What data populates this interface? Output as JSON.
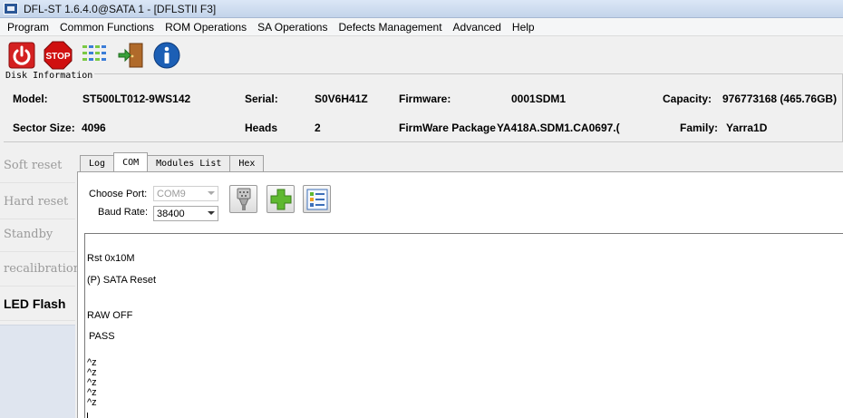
{
  "window": {
    "title": "DFL-ST 1.6.4.0@SATA 1 - [DFLSTII  F3]"
  },
  "menu": [
    "Program",
    "Common Functions",
    "ROM Operations",
    "SA Operations",
    "Defects Management",
    "Advanced",
    "Help"
  ],
  "toolbar": {
    "icons": [
      "power-icon",
      "stop-icon",
      "grid-icon",
      "exit-door-icon",
      "info-icon"
    ],
    "stop_label": "STOP"
  },
  "disk_info": {
    "legend": "Disk Information",
    "model_label": "Model:",
    "model": "ST500LT012-9WS142",
    "serial_label": "Serial:",
    "serial": "S0V6H41Z",
    "firmware_label": "Firmware:",
    "firmware": "0001SDM1",
    "capacity_label": "Capacity:",
    "capacity": "976773168 (465.76GB)",
    "sector_size_label": "Sector Size:",
    "sector_size": "4096",
    "heads_label": "Heads",
    "heads": "2",
    "firmware_package_label": "FirmWare Package",
    "firmware_package": "YA418A.SDM1.CA0697.(",
    "family_label": "Family:",
    "family": "Yarra1D"
  },
  "left_panel": {
    "items": [
      "Soft reset",
      "Hard reset",
      "Standby",
      "recalibration",
      "LED Flash"
    ],
    "active_index": 4
  },
  "tabs": {
    "items": [
      "Log",
      "COM",
      "Modules List",
      "Hex"
    ],
    "active_index": 1
  },
  "com_panel": {
    "choose_port_label": "Choose Port:",
    "port_value": "COM9",
    "baud_rate_label": "Baud Rate:",
    "baud_value": "38400",
    "buttons": [
      "serial-connector-icon",
      "add-plus-icon",
      "list-settings-icon"
    ]
  },
  "console": {
    "lines": [
      "Rst 0x10M",
      "(P) SATA Reset",
      "RAW OFF",
      " PASS",
      "^z",
      "^z",
      "^z",
      "^z",
      "^z"
    ]
  },
  "colors": {
    "titlebar": "#c3d4ea",
    "power_red": "#d42020",
    "stop_red": "#d01010",
    "info_blue": "#1c5fb5",
    "plus_green": "#5fb830",
    "left_fill": "#dfe5ef"
  }
}
